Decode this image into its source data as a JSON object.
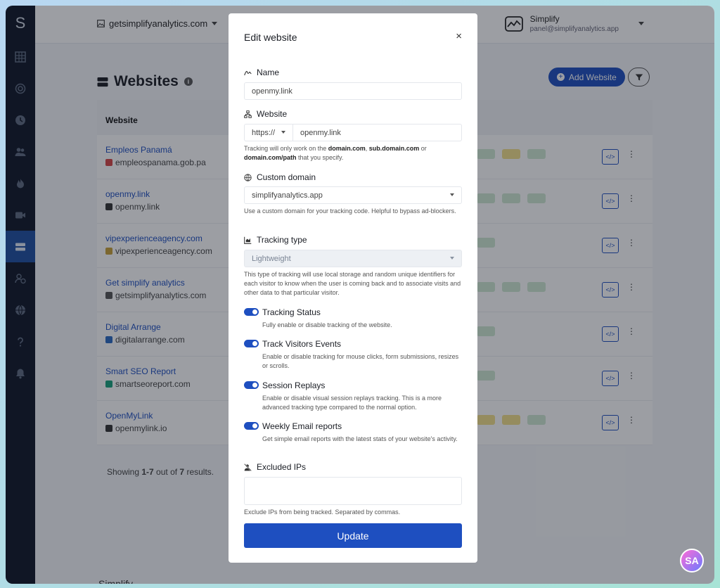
{
  "sidebar": {
    "logo": "S"
  },
  "topbar": {
    "domain": "getsimplifyanalytics.com",
    "user_name": "Simplify",
    "user_email": "panel@simplifyanalytics.app"
  },
  "page": {
    "title": "Websites",
    "add_label": "Add Website",
    "column_header": "Website",
    "showing_prefix": "Showing ",
    "showing_range": "1-7",
    "showing_middle": " out of ",
    "showing_total": "7",
    "showing_suffix": " results.",
    "footer_brand": "Simplify",
    "code_label": "</>",
    "menu_label": "⋮"
  },
  "websites": [
    {
      "name": "Empleos Panamá",
      "url": "empleospanama.gob.pa",
      "favicon": "#d64545",
      "pills": [
        [
          "#cfe8d2",
          ""
        ],
        [
          "#f3e08a",
          ""
        ],
        [
          "#cfe8d2",
          ""
        ]
      ]
    },
    {
      "name": "openmy.link",
      "url": "openmy.link",
      "favicon": "#333333",
      "pills": [
        [
          "#cfe8d2",
          ""
        ],
        [
          "#cfe8d2",
          ""
        ],
        [
          "#cfe8d2",
          ""
        ]
      ]
    },
    {
      "name": "vipexperienceagency.com",
      "url": "vipexperienceagency.com",
      "favicon": "#c9a038",
      "pills": [
        [
          "#cfe8d2",
          ""
        ]
      ]
    },
    {
      "name": "Get simplify analytics",
      "url": "getsimplifyanalytics.com",
      "favicon": "#555555",
      "pills": [
        [
          "#cfe8d2",
          ""
        ],
        [
          "#cfe8d2",
          ""
        ],
        [
          "#cfe8d2",
          ""
        ]
      ]
    },
    {
      "name": "Digital Arrange",
      "url": "digitalarrange.com",
      "favicon": "#2a6ac2",
      "pills": [
        [
          "#cfe8d2",
          ""
        ]
      ]
    },
    {
      "name": "Smart SEO Report",
      "url": "smartseoreport.com",
      "favicon": "#19a37c",
      "pills": [
        [
          "#cfe8d2",
          ""
        ]
      ]
    },
    {
      "name": "OpenMyLink",
      "url": "openmylink.io",
      "favicon": "#333333",
      "pills": [
        [
          "#f3e08a",
          ""
        ],
        [
          "#f3e08a",
          ""
        ],
        [
          "#cfe8d2",
          ""
        ]
      ]
    }
  ],
  "modal": {
    "title": "Edit website",
    "close": "×",
    "name_label": "Name",
    "name_value": "openmy.link",
    "website_label": "Website",
    "protocol": "https://",
    "website_value": "openmy.link",
    "website_help_1": "Tracking will only work on the ",
    "website_help_b1": "domain.com",
    "website_help_2": ", ",
    "website_help_b2": "sub.domain.com",
    "website_help_3": " or ",
    "website_help_b3": "domain.com/path",
    "website_help_4": " that you specify.",
    "custom_domain_label": "Custom domain",
    "custom_domain_value": "simplifyanalytics.app",
    "custom_domain_help": "Use a custom domain for your tracking code. Helpful to bypass ad-blockers.",
    "tracking_type_label": "Tracking type",
    "tracking_type_value": "Lightweight",
    "tracking_type_help": "This type of tracking will use local storage and random unique identifiers for each visitor to know when the user is coming back and to associate visits and other data to that particular visitor.",
    "toggles": [
      {
        "label": "Tracking Status",
        "help": "Fully enable or disable tracking of the website."
      },
      {
        "label": "Track Visitors Events",
        "help": "Enable or disable tracking for mouse clicks, form submissions, resizes or scrolls."
      },
      {
        "label": "Session Replays",
        "help": "Enable or disable visual session replays tracking. This is a more advanced tracking type compared to the normal option."
      },
      {
        "label": "Weekly Email reports",
        "help": "Get simple email reports with the latest stats of your website's activity."
      }
    ],
    "excluded_label": "Excluded IPs",
    "excluded_help": "Exclude IPs from being tracked. Separated by commas.",
    "update_label": "Update"
  },
  "avatar": "SA",
  "colors": {
    "accent": "#1e4fc0",
    "sidebar": "#0e1626"
  }
}
